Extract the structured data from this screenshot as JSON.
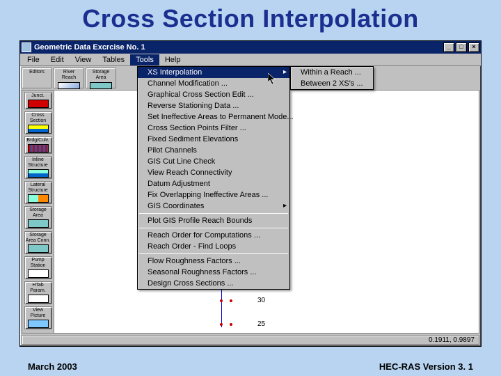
{
  "slide": {
    "title": "Cross Section Interpolation"
  },
  "window": {
    "title": "Geometric Data   Excrcise No. 1",
    "min": "_",
    "max": "□",
    "close": "×"
  },
  "menubar": {
    "items": [
      "File",
      "Edit",
      "View",
      "Tables",
      "Tools",
      "Help"
    ],
    "open_index": 4
  },
  "top_tools": {
    "a": "Editors",
    "b": "River\nReach",
    "c": "Storage\nArea"
  },
  "toolbar": [
    {
      "label": "Junct.",
      "sw": "#d00000"
    },
    {
      "label": "Cross\nSection",
      "sw": "linear-gradient(#ff0,#ff0 50%,#06c 50%)"
    },
    {
      "label": "Brdg/Culv.",
      "sw": "repeating-linear-gradient(90deg,#d00,#d00 3px,#06c 3px,#06c 6px)"
    },
    {
      "label": "Inline\nStructure",
      "sw": "linear-gradient(#8fd,#8fd 50%,#06c 50%)"
    },
    {
      "label": "Lateral\nStructure",
      "sw": "linear-gradient(90deg,#8fd,#8fd 50%,#f80 50%)"
    },
    {
      "label": "Storage\nArea",
      "sw": "#7ec8c8"
    },
    {
      "label": "Storage\nArea Conn.",
      "sw": "#7ec8c8"
    },
    {
      "label": "Pump\nStation",
      "sw": "#fff"
    },
    {
      "label": "HTab\nParam.",
      "sw": "#fff"
    },
    {
      "label": "View\nPicture",
      "sw": "#7ec8ff"
    }
  ],
  "tools_menu": {
    "groups": [
      [
        {
          "label": "XS Interpolation",
          "arrow": true,
          "selected": true
        },
        {
          "label": "Channel Modification ...",
          "arrow": false
        },
        {
          "label": "Graphical Cross Section Edit ...",
          "arrow": false
        },
        {
          "label": "Reverse Stationing Data ...",
          "arrow": false
        },
        {
          "label": "Set Ineffective Areas to Permanent Mode...",
          "arrow": false
        },
        {
          "label": "Cross Section Points Filter ...",
          "arrow": false
        },
        {
          "label": "Fixed Sediment Elevations",
          "arrow": false
        },
        {
          "label": "Pilot Channels",
          "arrow": false
        },
        {
          "label": "GIS Cut Line Check",
          "arrow": false
        },
        {
          "label": "View Reach Connectivity",
          "arrow": false
        },
        {
          "label": "Datum Adjustment",
          "arrow": false
        },
        {
          "label": "Fix Overlapping Ineffective Areas ...",
          "arrow": false
        },
        {
          "label": "GIS Coordinates",
          "arrow": true
        }
      ],
      [
        {
          "label": "Plot GIS Profile Reach Bounds",
          "arrow": false
        }
      ],
      [
        {
          "label": "Reach Order for Computations ...",
          "arrow": false
        },
        {
          "label": "Reach Order  - Find Loops",
          "arrow": false
        }
      ],
      [
        {
          "label": "Flow Roughness Factors ...",
          "arrow": false
        },
        {
          "label": "Seasonal Roughness Factors ...",
          "arrow": false
        },
        {
          "label": "Design Cross Sections ...",
          "arrow": false
        }
      ]
    ]
  },
  "submenu": {
    "items": [
      "Within a Reach ...",
      "Between 2 XS's ..."
    ]
  },
  "canvas": {
    "label1": "30",
    "label2": "25"
  },
  "status": {
    "coords": "0.1911, 0.9897"
  },
  "footer": {
    "left": "March 2003",
    "right": "HEC-RAS Version 3. 1"
  }
}
